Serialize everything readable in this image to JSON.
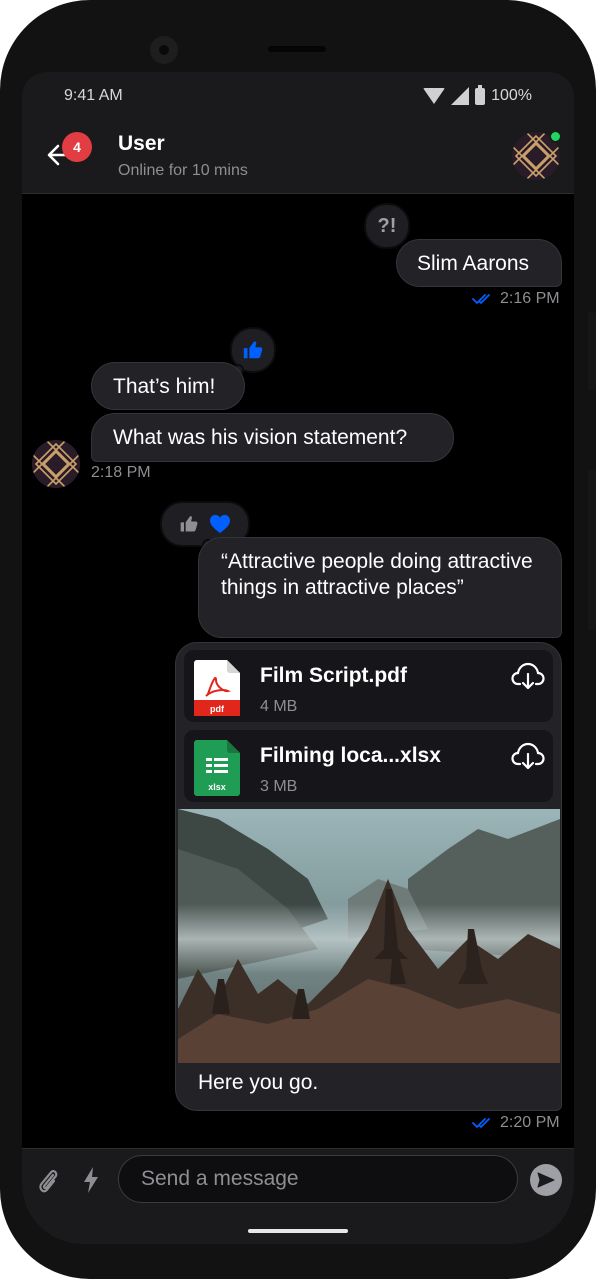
{
  "status_bar": {
    "time": "9:41 AM",
    "battery": "100%"
  },
  "header": {
    "unread_count": "4",
    "title": "User",
    "subtitle": "Online for 10 mins"
  },
  "messages": [
    {
      "from": "me",
      "text": "Slim Aarons",
      "time": "2:16 PM",
      "status": "read",
      "reaction": "?!"
    },
    {
      "from": "user",
      "text": "That’s him!",
      "reaction": "thumbs-up"
    },
    {
      "from": "user",
      "text": "What was his vision statement?",
      "time": "2:18 PM"
    },
    {
      "from": "me",
      "text": "“Attractive people doing attractive things in attractive places”",
      "reactions": [
        "thumbs-up",
        "heart"
      ]
    }
  ],
  "attachments": {
    "files": [
      {
        "name": "Film Script.pdf",
        "size": "4 MB",
        "type_label": "pdf"
      },
      {
        "name": "Filming loca...xlsx",
        "size": "3 MB",
        "type_label": "xlsx"
      }
    ],
    "caption": "Here you go.",
    "time": "2:20 PM",
    "status": "read"
  },
  "composer": {
    "placeholder": "Send a message"
  },
  "colors": {
    "accent": "#005fff",
    "badge": "#e23d42",
    "online": "#20d65e",
    "bubble": "#222227"
  }
}
